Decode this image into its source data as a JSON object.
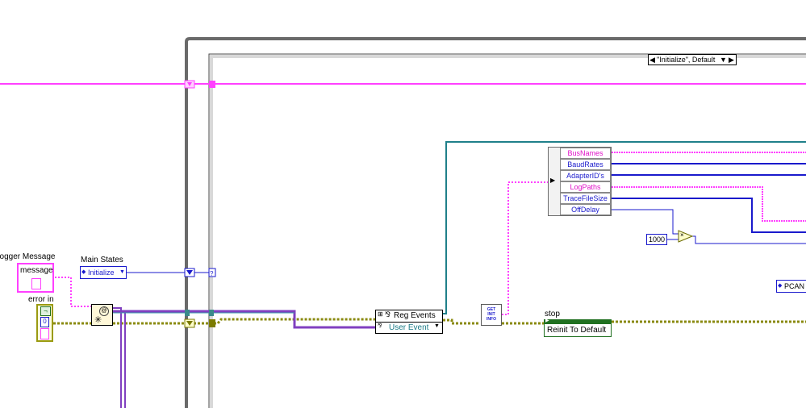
{
  "diagram": {
    "case_selector": "\"Initialize\", Default",
    "logger_message_label": "Logger Message",
    "message_control": "message",
    "error_in_label": "error in",
    "error_status": "¬",
    "error_code": "0",
    "main_states_label": "Main States",
    "main_states_value": "Initialize",
    "reg_events_label": "Reg Events",
    "user_event_value": "User Event",
    "get_init_info_lines": [
      "GET",
      "INIT",
      "INFO"
    ],
    "unbundle_items": [
      "BusNames",
      "BaudRates",
      "AdapterID's",
      "LogPaths",
      "TraceFileSize",
      "OffDelay"
    ],
    "constant_1000": "1000",
    "multiply_symbol": "×",
    "stop_label": "stop",
    "reinit_button": "Reinit To Default",
    "pcan_ref": "PCAN",
    "colors": {
      "pink_wire": "#ff40ff",
      "blue_wire": "#1a1acc",
      "error_wire": "#7a7a00",
      "event_wire": "#8040c0",
      "teal_wire": "#20808a",
      "frame_gray": "#6a6a6a"
    }
  }
}
